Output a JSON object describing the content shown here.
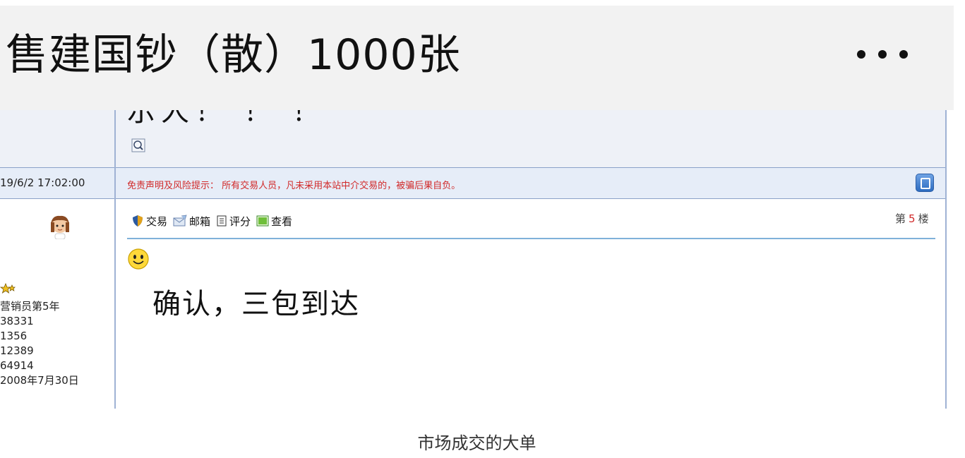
{
  "header": {
    "title": "售建国钞（散）1000张",
    "more_icon": "more-dots-icon"
  },
  "forum": {
    "previous_post_cut_text": "示人！ ！ ！",
    "post_time": "19/6/2 17:02:00",
    "disclaimer": "免责声明及风险提示： 所有交易人员，凡未采用本站中介交易的，被骗后果自负。",
    "actions": [
      {
        "label": "交易",
        "icon": "shield-icon"
      },
      {
        "label": "邮箱",
        "icon": "mail-icon"
      },
      {
        "label": "评分",
        "icon": "document-icon"
      },
      {
        "label": "查看",
        "icon": "image-icon"
      }
    ],
    "floor_prefix": "第",
    "floor_number": "5",
    "floor_suffix": "楼",
    "user_profile": [
      "营销员第5年",
      "38331",
      "1356",
      "12389",
      "64914",
      "2008年7月30日"
    ],
    "post_text": "确认，三包到达"
  },
  "caption": "市场成交的大单",
  "colors": {
    "header_bg": "#f2f2f2",
    "notice_red": "#d12a2a",
    "forum_border": "#9fb2d4",
    "row_bg": "#eef1f7"
  }
}
